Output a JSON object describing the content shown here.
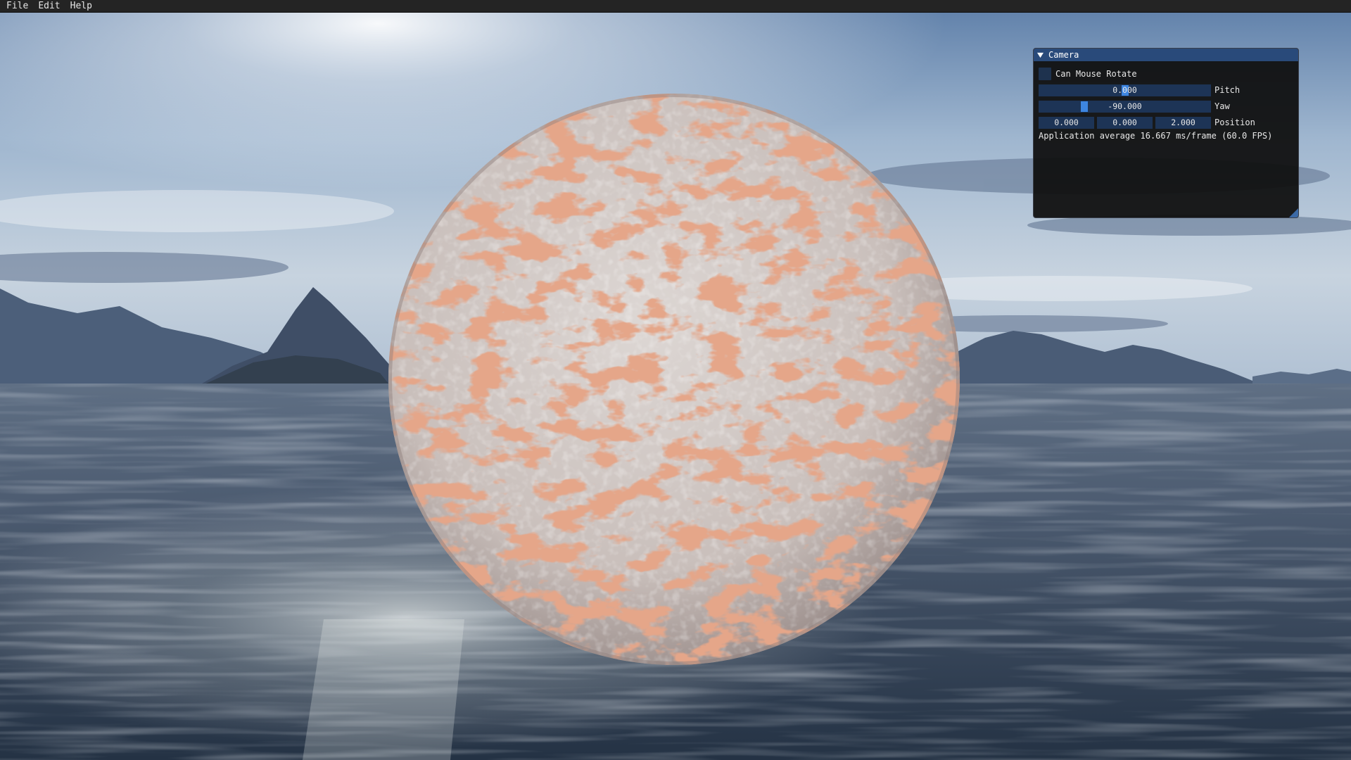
{
  "menubar": {
    "items": [
      "File",
      "Edit",
      "Help"
    ]
  },
  "camera_window": {
    "title": "Camera",
    "collapse_icon": "triangle-down-icon",
    "can_mouse_rotate": {
      "label": "Can Mouse Rotate",
      "checked": false
    },
    "pitch": {
      "value": "0.000",
      "label": "Pitch"
    },
    "yaw": {
      "value": "-90.000",
      "label": "Yaw"
    },
    "position": {
      "x": "0.000",
      "y": "0.000",
      "z": "2.000",
      "label": "Position"
    },
    "stats": "Application average 16.667 ms/frame (60.0 FPS)"
  },
  "colors": {
    "menubar_bg": "#242424",
    "window_bg": "#0f0f0f",
    "titlebar_bg": "#294a7a",
    "frame_bg": "#1d3456",
    "slider_grab": "#3d85e0"
  }
}
